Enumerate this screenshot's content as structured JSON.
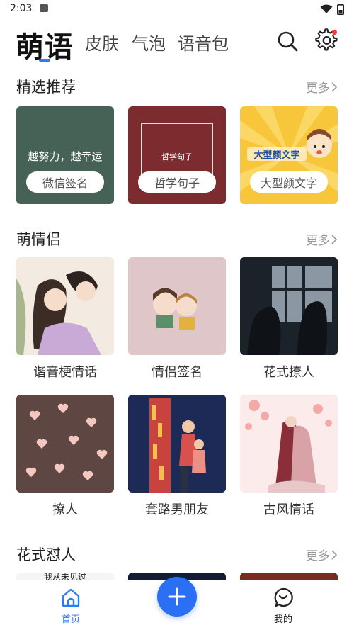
{
  "status": {
    "time": "2:03"
  },
  "tabs": {
    "main": "萌语",
    "skin": "皮肤",
    "bubble": "气泡",
    "voice": "语音包"
  },
  "sections": {
    "featured": {
      "title": "精选推荐",
      "more": "更多",
      "cards": [
        {
          "overlay": "越努力，越幸运",
          "pill": "微信签名"
        },
        {
          "overlay": "哲学句子",
          "pill": "哲学句子"
        },
        {
          "overlay": "大型颜文字",
          "pill": "大型颜文字"
        }
      ]
    },
    "couple": {
      "title": "萌情侣",
      "more": "更多",
      "items": [
        {
          "label": "谐音梗情话"
        },
        {
          "label": "情侣签名"
        },
        {
          "label": "花式撩人"
        },
        {
          "label": "撩人"
        },
        {
          "label": "套路男朋友"
        },
        {
          "label": "古风情话"
        }
      ]
    },
    "roast": {
      "title": "花式怼人",
      "more": "更多",
      "peek_text": "我从未见过"
    }
  },
  "bottom_nav": {
    "home": "首页",
    "mine": "我的"
  },
  "colors": {
    "accent": "#2b7cf6",
    "fab": "#2b6ff4",
    "badge": "#ff3b30"
  }
}
